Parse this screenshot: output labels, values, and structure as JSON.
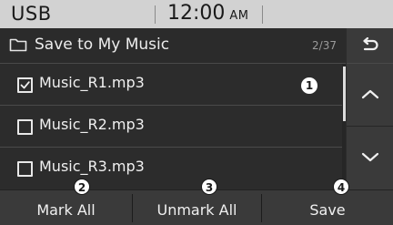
{
  "status_bar": {
    "source": "USB",
    "time": "12:00",
    "ampm": "AM"
  },
  "title_bar": {
    "icon": "folder-icon",
    "title": "Save to My Music",
    "page_counter": "2/37",
    "back_icon": "back-arrow-icon"
  },
  "list": {
    "items": [
      {
        "label": "Music_R1.mp3",
        "checked": true
      },
      {
        "label": "Music_R2.mp3",
        "checked": false
      },
      {
        "label": "Music_R3.mp3",
        "checked": false
      }
    ]
  },
  "side_buttons": {
    "up_icon": "chevron-up-icon",
    "down_icon": "chevron-down-icon"
  },
  "bottom_bar": {
    "mark_all": "Mark All",
    "unmark_all": "Unmark All",
    "save": "Save"
  },
  "callouts": {
    "one": "1",
    "two": "2",
    "three": "3",
    "four": "4"
  }
}
